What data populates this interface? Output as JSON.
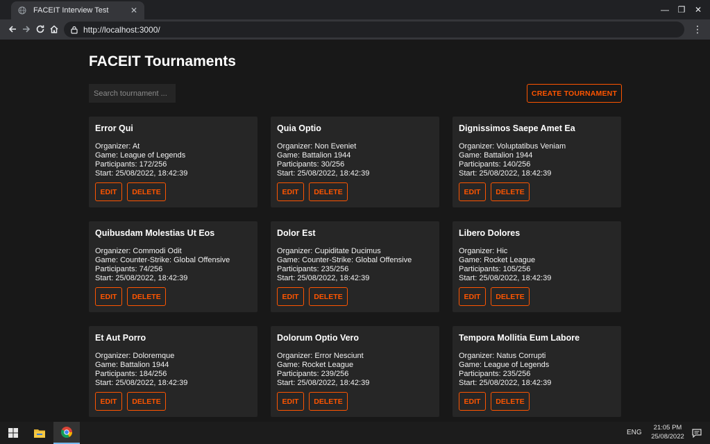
{
  "browser": {
    "tab_title": "FACEIT Interview Test",
    "tab_close": "✕",
    "url": "http://localhost:3000/",
    "window_controls": {
      "minimize": "—",
      "maximize": "❐",
      "close": "✕"
    },
    "menu": "⋮"
  },
  "page": {
    "title": "FACEIT Tournaments",
    "search_placeholder": "Search tournament ...",
    "create_label": "CREATE TOURNAMENT",
    "accent_color": "#ff5500"
  },
  "labels": {
    "organizer": "Organizer: ",
    "game": "Game: ",
    "participants": "Participants: ",
    "start": "Start: ",
    "edit": "EDIT",
    "delete": "DELETE"
  },
  "tournaments": [
    {
      "name": "Error Qui",
      "organizer": "At",
      "game": "League of Legends",
      "participants": "172/256",
      "start": "25/08/2022, 18:42:39"
    },
    {
      "name": "Quia Optio",
      "organizer": "Non Eveniet",
      "game": "Battalion 1944",
      "participants": "30/256",
      "start": "25/08/2022, 18:42:39"
    },
    {
      "name": "Dignissimos Saepe Amet Ea",
      "organizer": "Voluptatibus Veniam",
      "game": "Battalion 1944",
      "participants": "140/256",
      "start": "25/08/2022, 18:42:39"
    },
    {
      "name": "Quibusdam Molestias Ut Eos",
      "organizer": "Commodi Odit",
      "game": "Counter-Strike: Global Offensive",
      "participants": "74/256",
      "start": "25/08/2022, 18:42:39"
    },
    {
      "name": "Dolor Est",
      "organizer": "Cupiditate Ducimus",
      "game": "Counter-Strike: Global Offensive",
      "participants": "235/256",
      "start": "25/08/2022, 18:42:39"
    },
    {
      "name": "Libero Dolores",
      "organizer": "Hic",
      "game": "Rocket League",
      "participants": "105/256",
      "start": "25/08/2022, 18:42:39"
    },
    {
      "name": "Et Aut Porro",
      "organizer": "Doloremque",
      "game": "Battalion 1944",
      "participants": "184/256",
      "start": "25/08/2022, 18:42:39"
    },
    {
      "name": "Dolorum Optio Vero",
      "organizer": "Error Nesciunt",
      "game": "Rocket League",
      "participants": "239/256",
      "start": "25/08/2022, 18:42:39"
    },
    {
      "name": "Tempora Mollitia Eum Labore",
      "organizer": "Natus Corrupti",
      "game": "League of Legends",
      "participants": "235/256",
      "start": "25/08/2022, 18:42:39"
    }
  ],
  "taskbar": {
    "language": "ENG",
    "time": "21:05 PM",
    "date": "25/08/2022",
    "icons": [
      "windows-start-icon",
      "file-explorer-icon",
      "chrome-icon",
      "notification-icon"
    ]
  }
}
